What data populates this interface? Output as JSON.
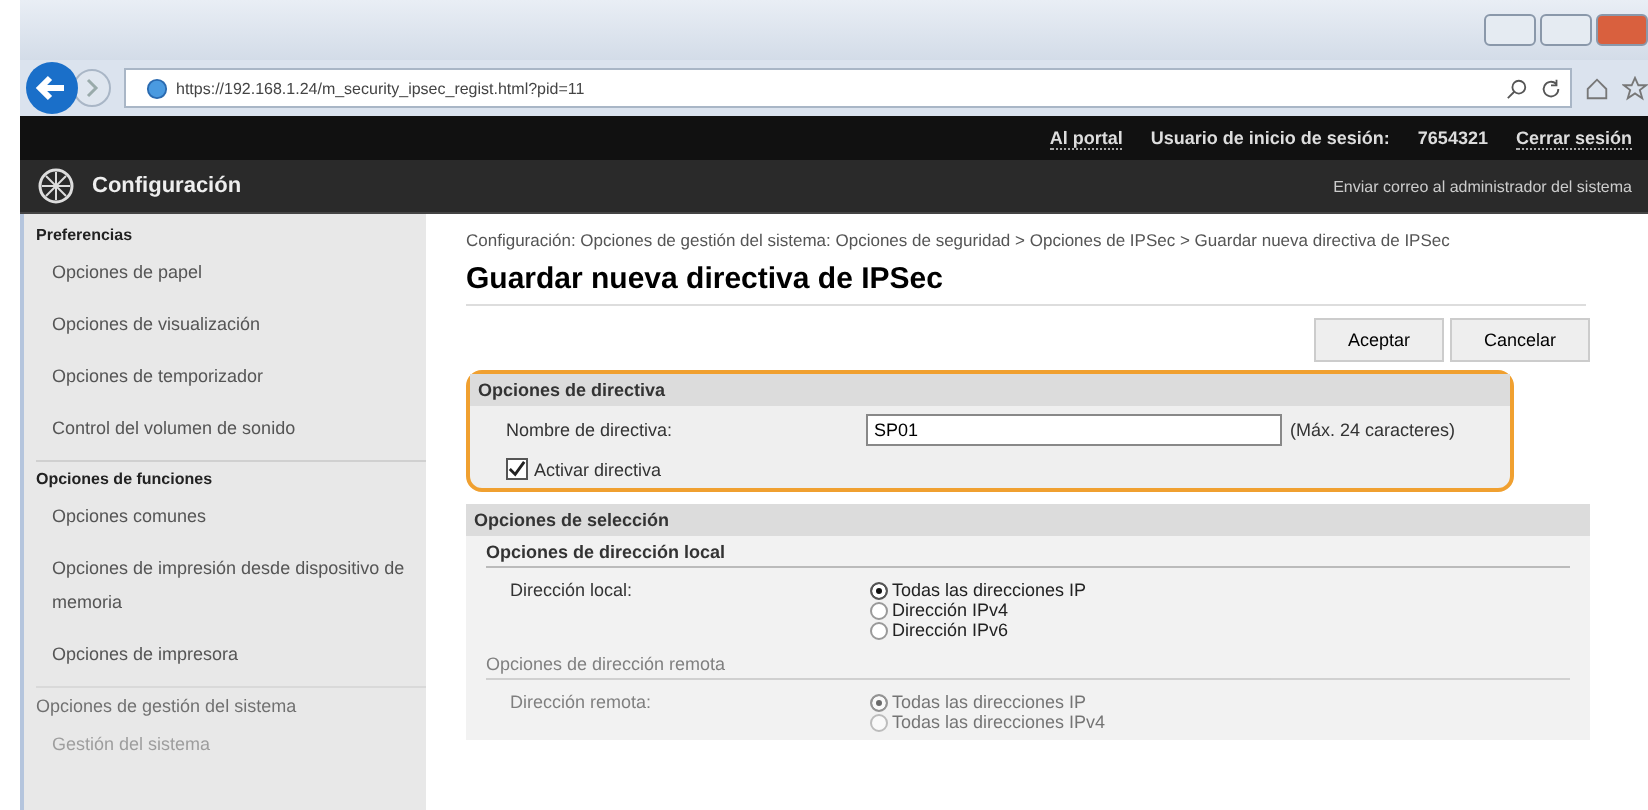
{
  "browser": {
    "url": "https://192.168.1.24/m_security_ipsec_regist.html?pid=11"
  },
  "header": {
    "links": [
      {
        "label": "Al portal"
      }
    ],
    "login_label": "Usuario de inicio de sesión:",
    "login_user": "7654321",
    "logout": "Cerrar sesión"
  },
  "app_bar": {
    "title": "Configuración",
    "mail_link": "Enviar correo al administrador del sistema"
  },
  "sidebar": {
    "sections": [
      {
        "title": "Preferencias",
        "items": [
          {
            "label": "Opciones de papel"
          },
          {
            "label": "Opciones de visualización"
          },
          {
            "label": "Opciones de temporizador"
          },
          {
            "label": "Control del volumen de sonido"
          }
        ]
      },
      {
        "title": "Opciones de funciones",
        "items": [
          {
            "label": "Opciones comunes"
          },
          {
            "label": "Opciones de impresión desde dispositivo de memoria"
          },
          {
            "label": "Opciones de impresora"
          }
        ]
      },
      {
        "title": "Opciones de gestión del sistema",
        "items": [
          {
            "label": "Gestión del sistema"
          }
        ]
      }
    ]
  },
  "breadcrumb": "Configuración: Opciones de gestión del sistema: Opciones de seguridad > Opciones de IPSec > Guardar nueva directiva de IPSec",
  "page_title": "Guardar nueva directiva de IPSec",
  "buttons": [
    "Aceptar",
    "Cancelar"
  ],
  "policy": {
    "title": "Opciones de directiva",
    "name_label": "Nombre de directiva:",
    "name_value": "SP01",
    "name_hint": "(Máx. 24 caracteres)",
    "enable_label": "Activar directiva",
    "enable_checked": true
  },
  "selection": {
    "title": "Opciones de selección",
    "groups": [
      {
        "title": "Opciones de dirección local",
        "field_label": "Dirección local:",
        "options": [
          {
            "label": "Todas las direcciones IP",
            "selected": true
          },
          {
            "label": "Dirección IPv4",
            "selected": false
          },
          {
            "label": "Dirección IPv6",
            "selected": false
          }
        ]
      },
      {
        "title": "Opciones de dirección remota",
        "field_label": "Dirección remota:",
        "options": [
          {
            "label": "Todas las direcciones IP",
            "selected": true
          },
          {
            "label": "Todas las direcciones IPv4",
            "selected": false
          }
        ]
      }
    ]
  }
}
